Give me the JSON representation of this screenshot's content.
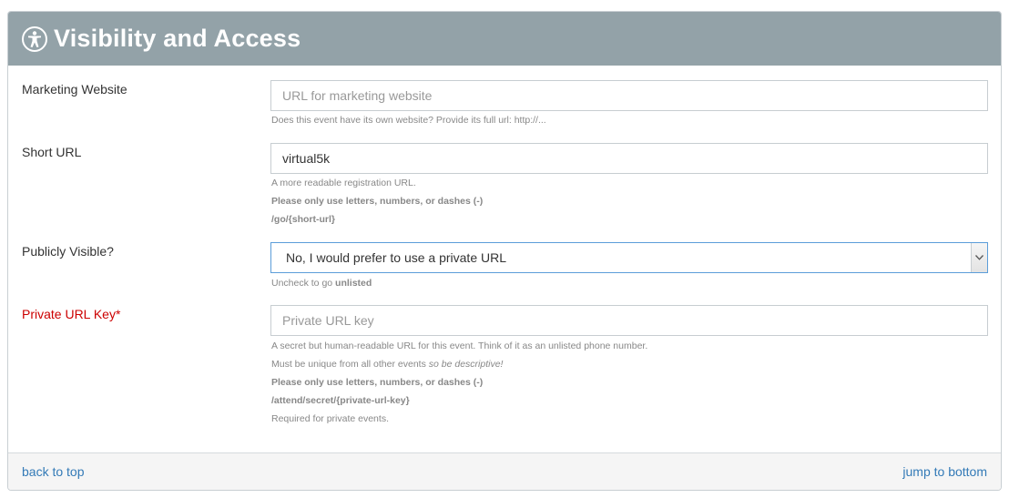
{
  "header": {
    "title": "Visibility and Access",
    "icon": "accessibility-icon"
  },
  "fields": {
    "marketing_website": {
      "label": "Marketing Website",
      "placeholder": "URL for marketing website",
      "value": "",
      "help": "Does this event have its own website? Provide its full url: http://..."
    },
    "short_url": {
      "label": "Short URL",
      "value": "virtual5k",
      "help_lines": [
        "A more readable registration URL.",
        "Please only use letters, numbers, or dashes (-)",
        "/go/{short-url}"
      ]
    },
    "publicly_visible": {
      "label": "Publicly Visible?",
      "selected": "No, I would prefer to use a private URL",
      "help_prefix": "Uncheck to go",
      "help_bold": "unlisted"
    },
    "private_url_key": {
      "label": "Private URL Key*",
      "placeholder": "Private URL key",
      "value": "",
      "help_line1": "A secret but human-readable URL for this event. Think of it as an unlisted phone number.",
      "help_line2_prefix": "Must be unique from all other events",
      "help_line2_italic": "so be descriptive!",
      "help_line3": "Please only use letters, numbers, or dashes (-)",
      "help_line4": "/attend/secret/{private-url-key}",
      "help_line5": "Required for private events."
    }
  },
  "footer": {
    "back_to_top": "back to top",
    "jump_to_bottom": "jump to bottom"
  },
  "colors": {
    "header_bg": "#93a2a8",
    "link": "#337ab7",
    "required": "#cc0000",
    "select_border": "#5b9dd9"
  }
}
